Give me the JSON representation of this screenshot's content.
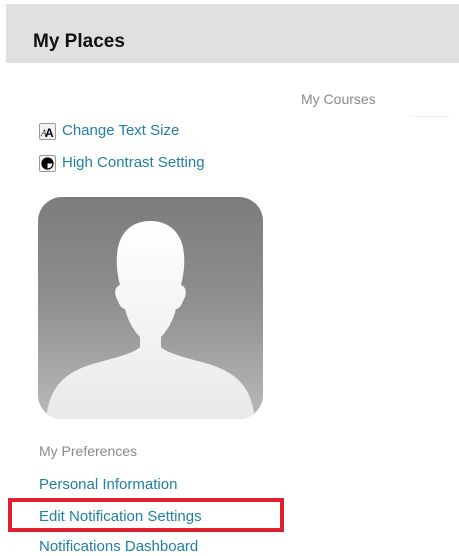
{
  "header": {
    "title": "My Places"
  },
  "courses": {
    "label": "My Courses"
  },
  "tools": {
    "items": [
      {
        "label": "Change Text Size",
        "icon": "text-size-icon"
      },
      {
        "label": "High Contrast Setting",
        "icon": "contrast-icon"
      }
    ]
  },
  "avatar": {
    "icon": "default-avatar-silhouette"
  },
  "preferences": {
    "heading": "My Preferences",
    "links": [
      {
        "label": "Personal Information"
      },
      {
        "label": "Edit Notification Settings",
        "highlighted": true
      },
      {
        "label": "Notifications Dashboard"
      }
    ]
  },
  "colors": {
    "link": "#1f7fa6",
    "muted": "#8a8a8a",
    "header_bg": "#e0e0e0",
    "highlight": "#e0202e"
  }
}
